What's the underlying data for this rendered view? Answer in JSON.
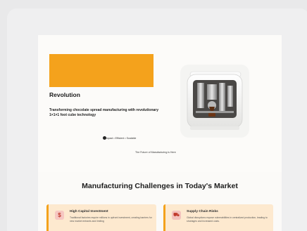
{
  "hero": {
    "title": "Revolution",
    "subtitle": "Transforming chocolate spread manufacturing with revolutionary 1×1×1 foot cube technology",
    "tagline": "Compact • Efficient • Scalable",
    "footer_line": "The Future of Manufacturing is Here",
    "accent_color": "#f4a21c"
  },
  "section": {
    "title": "Manufacturing Challenges in Today's Market"
  },
  "challenges": [
    {
      "icon": "dollar-icon",
      "icon_glyph": "$",
      "title": "High Capital Investment",
      "text": "Traditional factories require millions in upfront investment, creating barriers for new market entrants and limiting"
    },
    {
      "icon": "truck-icon",
      "icon_glyph": "⛟",
      "title": "Supply Chain Risks",
      "text": "Global disruptions expose vulnerabilities in centralized production, leading to shortages and increased costs."
    }
  ]
}
